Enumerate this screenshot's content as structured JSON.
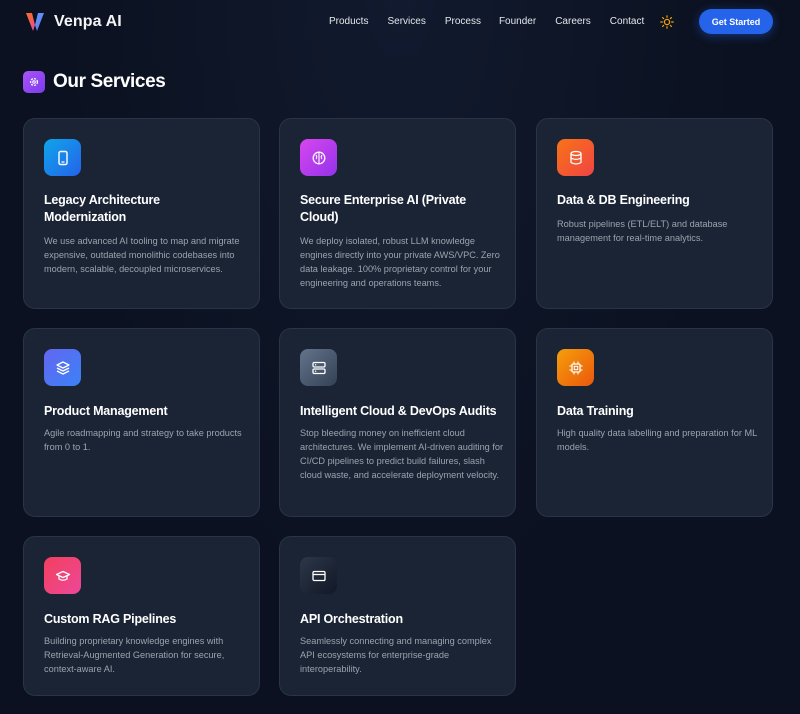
{
  "brand": {
    "name": "Venpa AI"
  },
  "nav": {
    "items": [
      "Products",
      "Services",
      "Process",
      "Founder",
      "Careers",
      "Contact"
    ],
    "theme_toggle_icon": "sun-icon",
    "cta_label": "Get Started"
  },
  "section": {
    "title": "Our Services",
    "icon": "gear-icon"
  },
  "colors": {
    "accent": "#2563eb",
    "card_bg": "#1b2435",
    "page_bg": "#0b1120"
  },
  "services": [
    {
      "title": "Legacy Architecture Modernization",
      "description": "We use advanced AI tooling to map and migrate expensive, outdated monolithic codebases into modern, scalable, decoupled microservices.",
      "icon": "tablet-icon",
      "icon_color": "#0ea5e9"
    },
    {
      "title": "Secure Enterprise AI (Private Cloud)",
      "description": "We deploy isolated, robust LLM knowledge engines directly into your private AWS/VPC. Zero data leakage. 100% proprietary control for your engineering and operations teams.",
      "icon": "brain-icon",
      "icon_color": "#c026d3"
    },
    {
      "title": "Data & DB Engineering",
      "description": "Robust pipelines (ETL/ELT) and database management for real-time analytics.",
      "icon": "database-icon",
      "icon_color": "#ef4444"
    },
    {
      "title": "Product Management",
      "description": "Agile roadmapping and strategy to take products from 0 to 1.",
      "icon": "layers-icon",
      "icon_color": "#6366f1"
    },
    {
      "title": "Intelligent Cloud & DevOps Audits",
      "description": "Stop bleeding money on inefficient cloud architectures. We implement AI-driven auditing for CI/CD pipelines to predict build failures, slash cloud waste, and accelerate deployment velocity.",
      "icon": "server-icon",
      "icon_color": "#475569"
    },
    {
      "title": "Data Training",
      "description": "High quality data labelling and preparation for ML models.",
      "icon": "cpu-icon",
      "icon_color": "#f59e0b"
    },
    {
      "title": "Custom RAG Pipelines",
      "description": "Building proprietary knowledge engines with Retrieval-Augmented Generation for secure, context-aware AI.",
      "icon": "graduation-cap-icon",
      "icon_color": "#ec4899"
    },
    {
      "title": "API Orchestration",
      "description": "Seamlessly connecting and managing complex API ecosystems for enterprise-grade interoperability.",
      "icon": "card-icon",
      "icon_color": "#1f2937"
    }
  ]
}
